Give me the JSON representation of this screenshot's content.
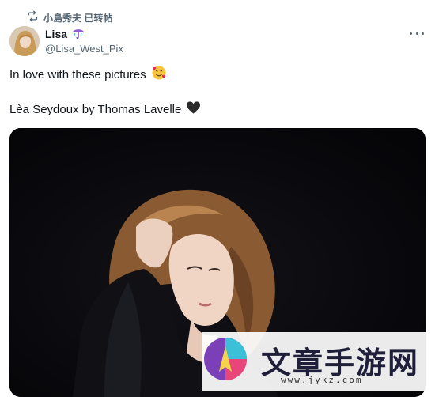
{
  "retweet": {
    "icon": "retweet-icon",
    "text": "小島秀夫 已转帖"
  },
  "author": {
    "display_name": "Lisa",
    "badge_icon": "umbrella-icon",
    "handle": "@Lisa_West_Pix",
    "avatar": "avatar"
  },
  "tweet": {
    "line1": "In love with these pictures",
    "line1_emoji": "smiling-face-with-hearts-icon",
    "line2": "Lèa Seydoux by Thomas Lavelle",
    "line2_emoji": "black-heart-icon"
  },
  "media": {
    "alt": "photo"
  },
  "watermark": {
    "text": "文章手游网",
    "url": "www.jykz.com"
  }
}
